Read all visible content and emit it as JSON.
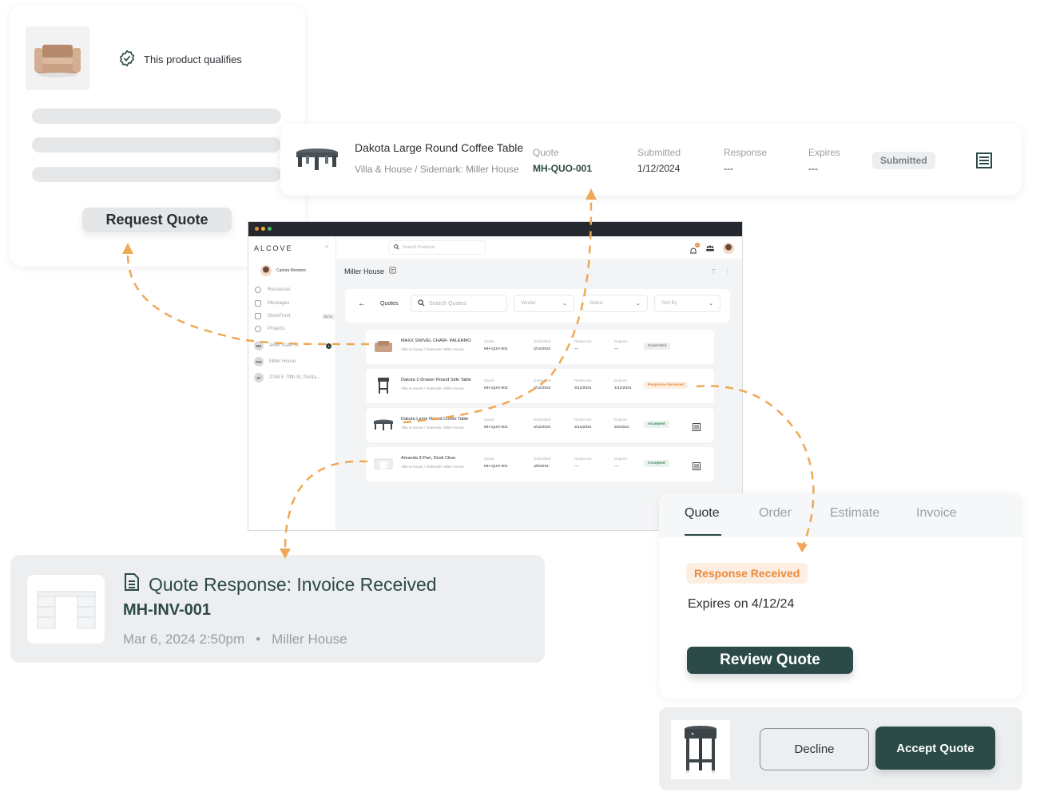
{
  "colors": {
    "accent_orange": "#e98a3b",
    "brand_dark_green": "#2b4a48",
    "accepted_green": "#3b8a57",
    "titlebar": "#25292d"
  },
  "qualify_card": {
    "product_image": "armchair",
    "qualify_icon": "verified-badge-icon",
    "qualify_text": "This product qualifies",
    "button_label": "Request Quote"
  },
  "quote_summary": {
    "product_image": "round-coffee-table",
    "product_name": "Dakota Large Round Coffee Table",
    "product_sub": "Villa & House  /  Sidemark: Miller House",
    "columns": [
      {
        "label": "Quote",
        "value": "MH-QUO-001"
      },
      {
        "label": "Submitted",
        "value": "1/12/2024"
      },
      {
        "label": "Response",
        "value": "---"
      },
      {
        "label": "Expires",
        "value": "---"
      }
    ],
    "status": "Submitted"
  },
  "app": {
    "brand": "ALCOVE",
    "collapse_icon": "«",
    "user_name": "Carlota Monteiro",
    "nav": [
      {
        "label": "Resources",
        "icon": "play-circle-icon"
      },
      {
        "label": "Messages",
        "icon": "mail-icon"
      },
      {
        "label": "StoreFront",
        "icon": "store-icon",
        "badge": "BETA"
      },
      {
        "label": "Projects",
        "icon": "palette-icon"
      }
    ],
    "projects": [
      {
        "initials": "MS",
        "label": "4466 State St.",
        "superscript": "2",
        "count": "4"
      },
      {
        "initials": "PW",
        "label": "Miller House"
      },
      {
        "initials": "27",
        "label": "2744 E 79th St. Portla..."
      }
    ],
    "search_products_placeholder": "Search Products",
    "notification_count": "11",
    "page_title": "Miller House",
    "quotes_label": "Quotes",
    "search_quotes_placeholder": "Search Quotes",
    "filters": [
      "Vendor",
      "Status",
      "Sort By"
    ],
    "column_labels": {
      "quote": "Quote",
      "submitted": "Submitted",
      "response": "Response",
      "expires": "Expires"
    },
    "quotes": [
      {
        "name": "MAXX SWIVEL CHAIR- PALERMO",
        "sub": "Villa & House  /  Sidemark: Miller House",
        "quote": "MH-QUO-004",
        "submitted": "3/14/2024",
        "response": "—",
        "expires": "—",
        "status": "Submitted",
        "status_type": "submitted",
        "has_doc": false
      },
      {
        "name": "Dakota 1-Drawer Round Side Table",
        "sub": "Villa & House  /  Sidemark: Miller House",
        "quote": "MH-QUO-003",
        "submitted": "3/12/2024",
        "response": "3/12/2024",
        "expires": "4/12/2024",
        "status": "Response Received",
        "status_type": "received",
        "has_doc": false
      },
      {
        "name": "Dakota Large Round Coffee Table",
        "sub": "Villa & House  /  Sidemark: Miller House",
        "quote": "MH-QUO-002",
        "submitted": "3/12/2024",
        "response": "3/12/2024",
        "expires": "5/2/2024",
        "status": "Accepted",
        "status_type": "accepted",
        "has_doc": true
      },
      {
        "name": "Amanda 3-Part, Desk Clear",
        "sub": "Villa & House  /  Sidemark: Miller House",
        "quote": "MH-QUO-001",
        "submitted": "3/5/2024",
        "response": "—",
        "expires": "—",
        "status": "Accepted",
        "status_type": "accepted",
        "has_doc": true
      }
    ]
  },
  "notification": {
    "product_image": "white-desk",
    "title": "Quote Response: Invoice Received",
    "code": "MH-INV-001",
    "datetime": "Mar 6, 2024 2:50pm",
    "separator": "•",
    "project": "Miller House"
  },
  "detail_tabs": {
    "tabs": [
      "Quote",
      "Order",
      "Estimate",
      "Invoice"
    ],
    "active_tab": "Quote",
    "status": "Response Received",
    "expires_text": "Expires on 4/12/24",
    "button_label": "Review Quote"
  },
  "actions": {
    "product_image": "round-side-table",
    "decline_label": "Decline",
    "accept_label": "Accept Quote"
  }
}
